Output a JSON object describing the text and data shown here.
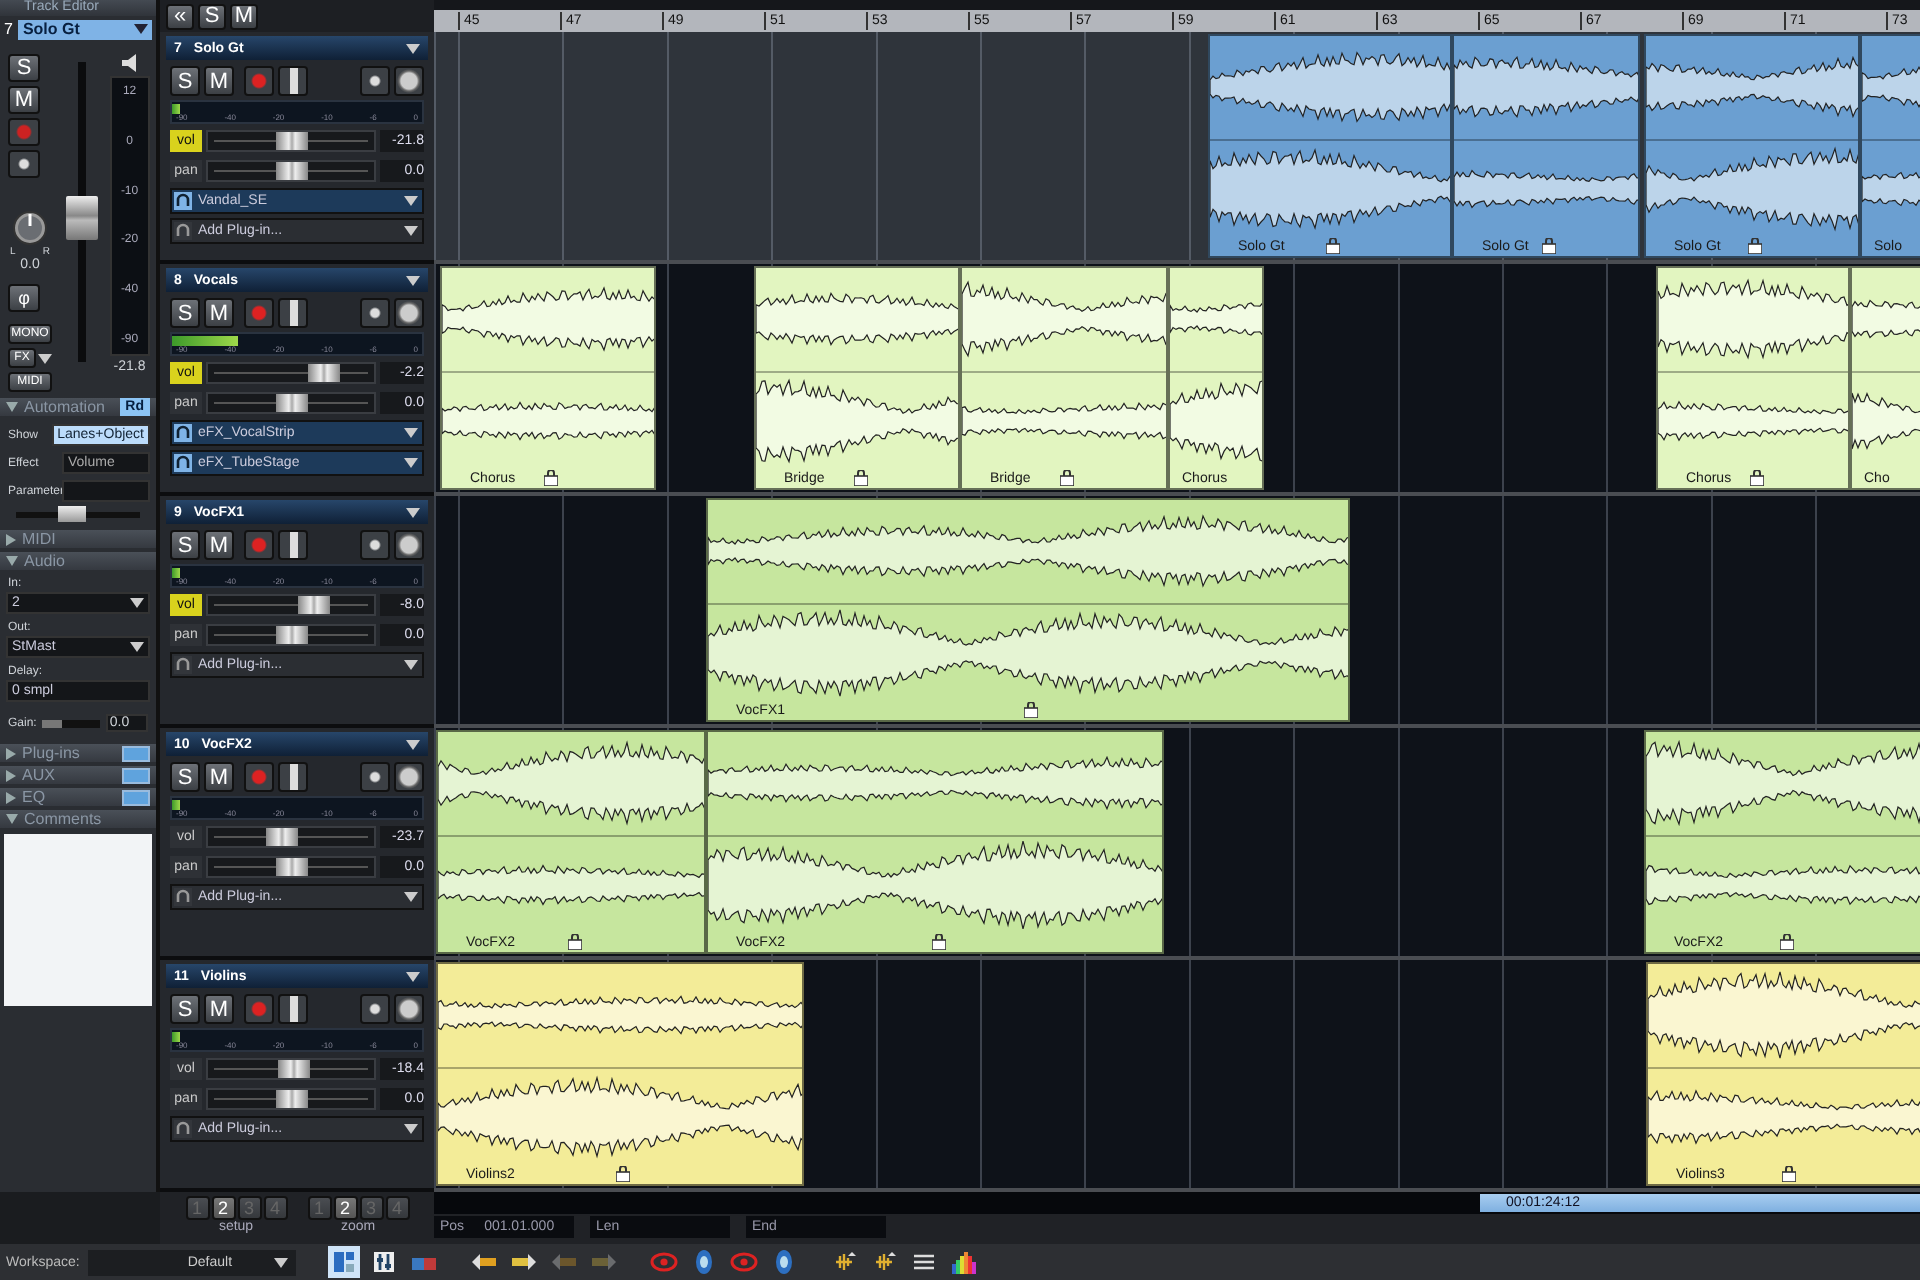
{
  "inspector": {
    "title": "Track Editor",
    "number": "7",
    "track": "Solo Gt",
    "solo": "S",
    "mute": "M",
    "pan_left": "L",
    "pan_right": "R",
    "pan_reading": "0.0",
    "fader": {
      "level": 0.48
    },
    "meter_scale": [
      "12",
      "0",
      "-10",
      "-20",
      "-40",
      "-90"
    ],
    "meter_reading": "-21.8",
    "phase": "φ",
    "mono": "MONO",
    "fx": "FX",
    "midi": "MIDI",
    "sections": [
      {
        "kind": "automation",
        "title": "Automation",
        "expanded": true,
        "mode": "Rd",
        "rows": [
          {
            "label": "Show",
            "value": "Lanes+Object",
            "selected": true
          },
          {
            "label": "Effect",
            "value": "Volume",
            "selected": false
          },
          {
            "label": "Parameter",
            "selected": false
          }
        ],
        "level": 0.45
      },
      {
        "kind": "plain",
        "title": "MIDI",
        "expanded": false
      },
      {
        "kind": "audio",
        "title": "Audio",
        "expanded": true,
        "rows": [
          {
            "label": "In:",
            "value": "2",
            "kind": "dropdown"
          },
          {
            "label": "Out:",
            "value": "StMast",
            "kind": "dropdown"
          },
          {
            "label": "Delay:",
            "value": "0 smpl",
            "kind": "field"
          }
        ],
        "gain": {
          "label": "Gain:",
          "level": 0.35,
          "reading": "0.0"
        }
      },
      {
        "kind": "toggle",
        "title": "Plug-ins",
        "expanded": false,
        "on": true
      },
      {
        "kind": "toggle",
        "title": "AUX",
        "expanded": false,
        "on": true
      },
      {
        "kind": "toggle",
        "title": "EQ",
        "expanded": false,
        "on": true
      },
      {
        "kind": "comments",
        "title": "Comments",
        "expanded": true
      }
    ]
  },
  "header_toolbar": {
    "buttons": [
      "«",
      "S",
      "M"
    ]
  },
  "ruler": {
    "labels": [
      "45",
      "47",
      "49",
      "51",
      "53",
      "55",
      "57",
      "59",
      "61",
      "63",
      "65",
      "67",
      "69",
      "71",
      "73"
    ]
  },
  "tracks": [
    {
      "number": "7",
      "name": "Solo Gt",
      "selected": true,
      "color": "#6b9fd1",
      "buttons": [
        "S",
        "M"
      ],
      "meter": {
        "level": 0.03
      },
      "meter_scale": [
        "-90",
        "-40",
        "-20",
        "-10",
        "-6",
        "0"
      ],
      "vol": {
        "label": "vol",
        "automation": true,
        "level": 0.5,
        "reading": "-21.8"
      },
      "pan": {
        "label": "pan",
        "level": 0.5,
        "reading": "0.0"
      },
      "plugins": [
        {
          "name": "Vandal_SE",
          "active": true
        },
        {
          "name": "Add Plug-in...",
          "active": false
        }
      ],
      "clips": [
        {
          "label": "Solo Gt"
        },
        {
          "label": "Solo Gt"
        },
        {
          "label": "Solo Gt"
        },
        {
          "label": "Solo"
        }
      ]
    },
    {
      "number": "8",
      "name": "Vocals",
      "selected": false,
      "color": "#e2f5c0",
      "buttons": [
        "S",
        "M"
      ],
      "meter": {
        "level": 0.26
      },
      "meter_scale": [
        "-90",
        "-40",
        "-20",
        "-10",
        "-6",
        "0"
      ],
      "vol": {
        "label": "vol",
        "automation": true,
        "level": 0.74,
        "reading": "-2.2"
      },
      "pan": {
        "label": "pan",
        "level": 0.5,
        "reading": "0.0"
      },
      "plugins": [
        {
          "name": "eFX_VocalStrip",
          "active": true
        },
        {
          "name": "eFX_TubeStage",
          "active": true
        }
      ],
      "clips": [
        {
          "label": "Chorus"
        },
        {
          "label": "Bridge"
        },
        {
          "label": "Bridge"
        },
        {
          "label": "Chorus"
        },
        {
          "label": "Chorus"
        },
        {
          "label": "Cho"
        }
      ]
    },
    {
      "number": "9",
      "name": "VocFX1",
      "selected": false,
      "color": "#c6e69e",
      "buttons": [
        "S",
        "M"
      ],
      "meter": {
        "level": 0.03
      },
      "meter_scale": [
        "-90",
        "-40",
        "-20",
        "-10",
        "-6",
        "0"
      ],
      "vol": {
        "label": "vol",
        "automation": true,
        "level": 0.66,
        "reading": "-8.0"
      },
      "pan": {
        "label": "pan",
        "level": 0.5,
        "reading": "0.0"
      },
      "plugins": [
        {
          "name": "Add Plug-in...",
          "active": false
        }
      ],
      "clips": [
        {
          "label": "VocFX1"
        }
      ]
    },
    {
      "number": "10",
      "name": "VocFX2",
      "selected": false,
      "color": "#c6e69e",
      "buttons": [
        "S",
        "M"
      ],
      "meter": {
        "level": 0.03
      },
      "meter_scale": [
        "-90",
        "-40",
        "-20",
        "-10",
        "-6",
        "0"
      ],
      "vol": {
        "label": "vol",
        "automation": false,
        "level": 0.43,
        "reading": "-23.7"
      },
      "pan": {
        "label": "pan",
        "level": 0.5,
        "reading": "0.0"
      },
      "plugins": [
        {
          "name": "Add Plug-in...",
          "active": false
        }
      ],
      "clips": [
        {
          "label": "VocFX2"
        },
        {
          "label": "VocFX2"
        },
        {
          "label": "VocFX2"
        }
      ]
    },
    {
      "number": "11",
      "name": "Violins",
      "selected": false,
      "color": "#f3ec98",
      "buttons": [
        "S",
        "M"
      ],
      "meter": {
        "level": 0.03
      },
      "meter_scale": [
        "-90",
        "-40",
        "-20",
        "-10",
        "-6",
        "0"
      ],
      "vol": {
        "label": "vol",
        "automation": false,
        "level": 0.52,
        "reading": "-18.4"
      },
      "pan": {
        "label": "pan",
        "level": 0.5,
        "reading": "0.0"
      },
      "plugins": [
        {
          "name": "Add Plug-in...",
          "active": false
        }
      ],
      "clips": [
        {
          "label": "Violins2"
        },
        {
          "label": "Violins3"
        }
      ]
    }
  ],
  "transport": {
    "groups": [
      {
        "label": "setup",
        "buttons": [
          {
            "label": "1",
            "selected": false
          },
          {
            "label": "2",
            "selected": true
          },
          {
            "label": "3",
            "selected": false
          },
          {
            "label": "4",
            "selected": false
          }
        ]
      },
      {
        "label": "zoom",
        "buttons": [
          {
            "label": "1",
            "selected": false
          },
          {
            "label": "2",
            "selected": true
          },
          {
            "label": "3",
            "selected": false
          },
          {
            "label": "4",
            "selected": false
          }
        ]
      }
    ],
    "time": "00:01:24:12",
    "fields": [
      {
        "label": "Pos",
        "value": "001.01.000"
      },
      {
        "label": "Len"
      },
      {
        "label": "End"
      }
    ]
  },
  "workspace": {
    "label": "Workspace:",
    "value": "Default",
    "tools": [
      {
        "kind": "layout",
        "selected": true,
        "disabled": false
      },
      {
        "kind": "mixer",
        "selected": false,
        "disabled": false
      },
      {
        "kind": "windows",
        "selected": false,
        "disabled": false
      },
      {
        "kind": "jump-back",
        "selected": false,
        "disabled": false
      },
      {
        "kind": "jump-forward",
        "selected": false,
        "disabled": false
      },
      {
        "kind": "jump-back",
        "selected": false,
        "disabled": true
      },
      {
        "kind": "jump-forward",
        "selected": false,
        "disabled": true
      },
      {
        "kind": "eye",
        "selected": false,
        "disabled": false
      },
      {
        "kind": "knob",
        "selected": false,
        "disabled": false
      },
      {
        "kind": "eye",
        "selected": false,
        "disabled": false
      },
      {
        "kind": "knob",
        "selected": false,
        "disabled": false
      },
      {
        "kind": "zoom-v",
        "selected": false,
        "disabled": false
      },
      {
        "kind": "zoom-v",
        "selected": false,
        "disabled": false
      },
      {
        "kind": "lines",
        "selected": false,
        "disabled": false
      },
      {
        "kind": "spectrum",
        "selected": false,
        "disabled": false
      }
    ]
  }
}
